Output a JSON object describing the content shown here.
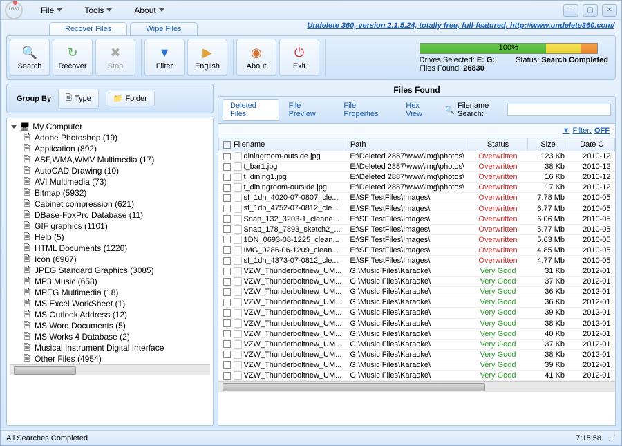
{
  "menu": {
    "file": "File",
    "tools": "Tools",
    "about": "About"
  },
  "tabs": {
    "recover": "Recover Files",
    "wipe": "Wipe Files"
  },
  "version_link": "Undelete 360, version 2.1.5.24, totally free, full-featured, http://www.undelete360.com/",
  "toolbar": {
    "search": "Search",
    "recover": "Recover",
    "stop": "Stop",
    "filter": "Filter",
    "english": "English",
    "about": "About",
    "exit": "Exit"
  },
  "status": {
    "progress_pct": "100%",
    "status_label": "Status:",
    "status_val": "Search Completed",
    "drives_label": "Drives Selected:",
    "drives_val": "E: G:",
    "files_label": "Files Found:",
    "files_val": "26830"
  },
  "groupby": {
    "label": "Group By",
    "type": "Type",
    "folder": "Folder"
  },
  "tree_root": "My Computer",
  "tree": [
    {
      "label": "Adobe Photoshop (19)"
    },
    {
      "label": "Application (892)"
    },
    {
      "label": "ASF,WMA,WMV Multimedia (17)"
    },
    {
      "label": "AutoCAD Drawing (10)"
    },
    {
      "label": "AVI Multimedia (73)"
    },
    {
      "label": "Bitmap (5932)"
    },
    {
      "label": "Cabinet compression (621)"
    },
    {
      "label": "DBase-FoxPro Database (11)"
    },
    {
      "label": "GIF graphics (1101)"
    },
    {
      "label": "Help (5)"
    },
    {
      "label": "HTML Documents (1220)"
    },
    {
      "label": "Icon (6907)"
    },
    {
      "label": "JPEG Standard Graphics (3085)"
    },
    {
      "label": "MP3 Music (658)"
    },
    {
      "label": "MPEG Multimedia (18)"
    },
    {
      "label": "MS Excel WorkSheet (1)"
    },
    {
      "label": "MS Outlook Address (12)"
    },
    {
      "label": "MS Word Documents (5)"
    },
    {
      "label": "MS Works 4 Database (2)"
    },
    {
      "label": "Musical Instrument Digital Interface"
    },
    {
      "label": "Other Files (4954)"
    }
  ],
  "found_title": "Files Found",
  "subtabs": {
    "deleted": "Deleted Files",
    "preview": "File Preview",
    "properties": "File Properties",
    "hex": "Hex View",
    "search_label": "Filename Search:"
  },
  "filter": {
    "label": "Filter:",
    "state": "OFF"
  },
  "columns": {
    "filename": "Filename",
    "path": "Path",
    "status": "Status",
    "size": "Size",
    "date": "Date C"
  },
  "rows": [
    {
      "fn": "diningroom-outside.jpg",
      "path": "E:\\Deleted 2887\\www\\img\\photos\\",
      "st": "Overwritten",
      "sz": "123 Kb",
      "dt": "2010-12"
    },
    {
      "fn": "t_bar1.jpg",
      "path": "E:\\Deleted 2887\\www\\img\\photos\\",
      "st": "Overwritten",
      "sz": "38 Kb",
      "dt": "2010-12"
    },
    {
      "fn": "t_dining1.jpg",
      "path": "E:\\Deleted 2887\\www\\img\\photos\\",
      "st": "Overwritten",
      "sz": "16 Kb",
      "dt": "2010-12"
    },
    {
      "fn": "t_diningroom-outside.jpg",
      "path": "E:\\Deleted 2887\\www\\img\\photos\\",
      "st": "Overwritten",
      "sz": "17 Kb",
      "dt": "2010-12"
    },
    {
      "fn": "sf_1dn_4020-07-0807_cle...",
      "path": "E:\\SF TestFiles\\Images\\",
      "st": "Overwritten",
      "sz": "7.78 Mb",
      "dt": "2010-05"
    },
    {
      "fn": "sf_1dn_4752-07-0812_cle...",
      "path": "E:\\SF TestFiles\\Images\\",
      "st": "Overwritten",
      "sz": "6.77 Mb",
      "dt": "2010-05"
    },
    {
      "fn": "Snap_132_3203-1_cleane...",
      "path": "E:\\SF TestFiles\\Images\\",
      "st": "Overwritten",
      "sz": "6.06 Mb",
      "dt": "2010-05"
    },
    {
      "fn": "Snap_178_7893_sketch2_...",
      "path": "E:\\SF TestFiles\\Images\\",
      "st": "Overwritten",
      "sz": "5.77 Mb",
      "dt": "2010-05"
    },
    {
      "fn": "1DN_0693-08-1225_clean...",
      "path": "E:\\SF TestFiles\\Images\\",
      "st": "Overwritten",
      "sz": "5.63 Mb",
      "dt": "2010-05"
    },
    {
      "fn": "IMG_0286-06-1209_clean...",
      "path": "E:\\SF TestFiles\\Images\\",
      "st": "Overwritten",
      "sz": "4.85 Mb",
      "dt": "2010-05"
    },
    {
      "fn": "sf_1dn_4373-07-0812_cle...",
      "path": "E:\\SF TestFiles\\Images\\",
      "st": "Overwritten",
      "sz": "4.77 Mb",
      "dt": "2010-05"
    },
    {
      "fn": "VZW_Thunderboltnew_UM...",
      "path": "G:\\Music Files\\Karaoke\\",
      "st": "Very Good",
      "sz": "31 Kb",
      "dt": "2012-01"
    },
    {
      "fn": "VZW_Thunderboltnew_UM...",
      "path": "G:\\Music Files\\Karaoke\\",
      "st": "Very Good",
      "sz": "37 Kb",
      "dt": "2012-01"
    },
    {
      "fn": "VZW_Thunderboltnew_UM...",
      "path": "G:\\Music Files\\Karaoke\\",
      "st": "Very Good",
      "sz": "36 Kb",
      "dt": "2012-01"
    },
    {
      "fn": "VZW_Thunderboltnew_UM...",
      "path": "G:\\Music Files\\Karaoke\\",
      "st": "Very Good",
      "sz": "36 Kb",
      "dt": "2012-01"
    },
    {
      "fn": "VZW_Thunderboltnew_UM...",
      "path": "G:\\Music Files\\Karaoke\\",
      "st": "Very Good",
      "sz": "39 Kb",
      "dt": "2012-01"
    },
    {
      "fn": "VZW_Thunderboltnew_UM...",
      "path": "G:\\Music Files\\Karaoke\\",
      "st": "Very Good",
      "sz": "38 Kb",
      "dt": "2012-01"
    },
    {
      "fn": "VZW_Thunderboltnew_UM...",
      "path": "G:\\Music Files\\Karaoke\\",
      "st": "Very Good",
      "sz": "40 Kb",
      "dt": "2012-01"
    },
    {
      "fn": "VZW_Thunderboltnew_UM...",
      "path": "G:\\Music Files\\Karaoke\\",
      "st": "Very Good",
      "sz": "37 Kb",
      "dt": "2012-01"
    },
    {
      "fn": "VZW_Thunderboltnew_UM...",
      "path": "G:\\Music Files\\Karaoke\\",
      "st": "Very Good",
      "sz": "38 Kb",
      "dt": "2012-01"
    },
    {
      "fn": "VZW_Thunderboltnew_UM...",
      "path": "G:\\Music Files\\Karaoke\\",
      "st": "Very Good",
      "sz": "39 Kb",
      "dt": "2012-01"
    },
    {
      "fn": "VZW_Thunderboltnew_UM...",
      "path": "G:\\Music Files\\Karaoke\\",
      "st": "Very Good",
      "sz": "41 Kb",
      "dt": "2012-01"
    }
  ],
  "statusbar": {
    "msg": "All Searches Completed",
    "time": "7:15:58"
  }
}
